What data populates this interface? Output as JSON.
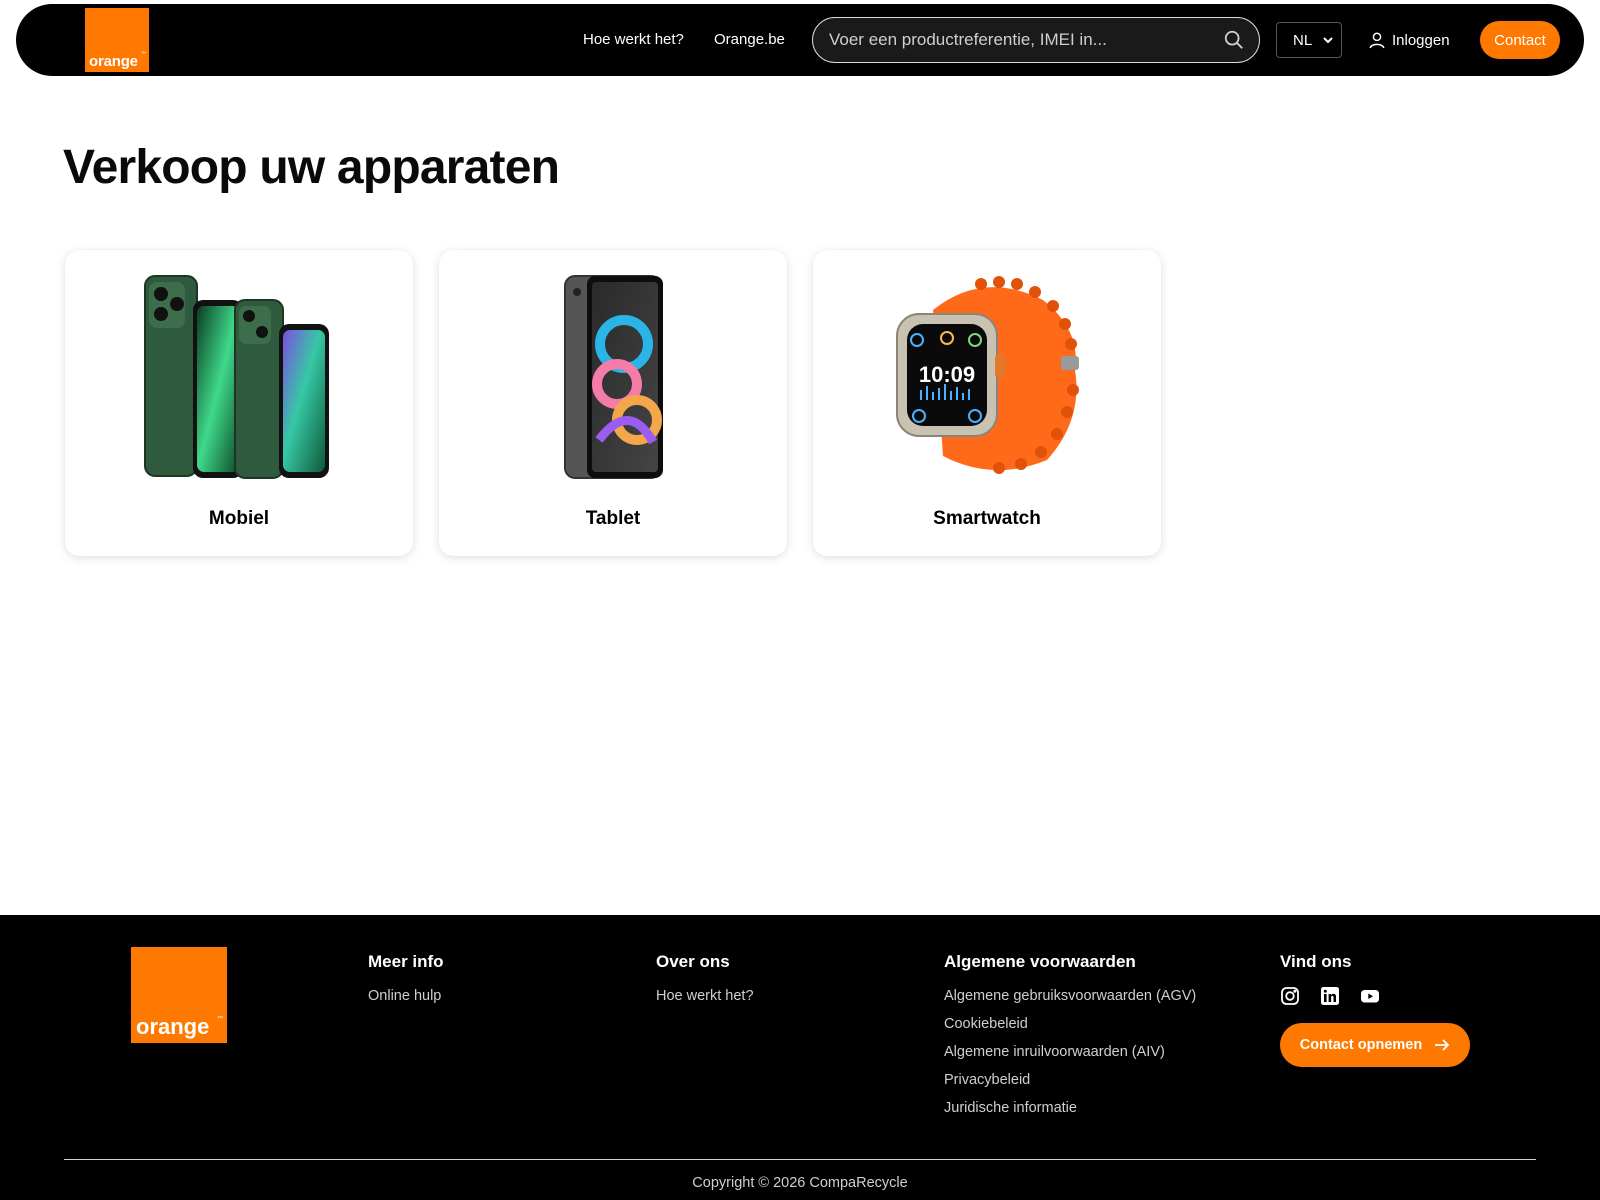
{
  "brand": {
    "logo_text": "orange",
    "logo_tm": "™",
    "color": "#ff7900"
  },
  "header": {
    "nav": [
      {
        "label": "Hoe werkt het?"
      },
      {
        "label": "Orange.be"
      }
    ],
    "search": {
      "placeholder": "Voer een productreferentie, IMEI in...",
      "icon": "search-icon"
    },
    "language": {
      "selected": "NL"
    },
    "login_label": "Inloggen",
    "contact_label": "Contact"
  },
  "main": {
    "title": "Verkoop uw apparaten",
    "categories": [
      {
        "label": "Mobiel",
        "icon": "phones-image"
      },
      {
        "label": "Tablet",
        "icon": "tablet-image"
      },
      {
        "label": "Smartwatch",
        "icon": "smartwatch-image"
      }
    ]
  },
  "footer": {
    "logo_text": "orange",
    "columns": [
      {
        "title": "Meer info",
        "links": [
          "Online hulp"
        ]
      },
      {
        "title": "Over ons",
        "links": [
          "Hoe werkt het?"
        ]
      },
      {
        "title": "Algemene voorwaarden",
        "links": [
          "Algemene gebruiksvoorwaarden (AGV)",
          "Cookiebeleid",
          "Algemene inruilvoorwaarden (AIV)",
          "Privacybeleid",
          "Juridische informatie"
        ]
      },
      {
        "title": "Vind ons"
      }
    ],
    "social": [
      "instagram-icon",
      "linkedin-icon",
      "youtube-icon"
    ],
    "cta_label": "Contact opnemen",
    "copyright": "Copyright © 2026 CompaRecycle"
  }
}
